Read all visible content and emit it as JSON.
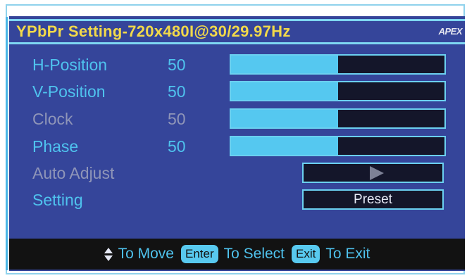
{
  "title": "YPbPr Setting-720x480I@30/29.97Hz",
  "brand": "APEX",
  "colors": {
    "accent": "#4fc3ee",
    "title": "#f2d94a",
    "background": "#35459a",
    "disabled": "#8f95b8"
  },
  "rows": [
    {
      "label": "H-Position",
      "value": "50",
      "level": 0.5,
      "enabled": true
    },
    {
      "label": "V-Position",
      "value": "50",
      "level": 0.5,
      "enabled": true
    },
    {
      "label": "Clock",
      "value": "50",
      "level": 0.5,
      "enabled": false
    },
    {
      "label": "Phase",
      "value": "50",
      "level": 0.5,
      "enabled": true
    }
  ],
  "auto_adjust": {
    "label": "Auto Adjust",
    "icon": "play-icon"
  },
  "setting": {
    "label": "Setting",
    "value": "Preset"
  },
  "footer": {
    "move": "To Move",
    "enter_key": "Enter",
    "select": "To Select",
    "exit_key": "Exit",
    "exit": "To Exit"
  }
}
